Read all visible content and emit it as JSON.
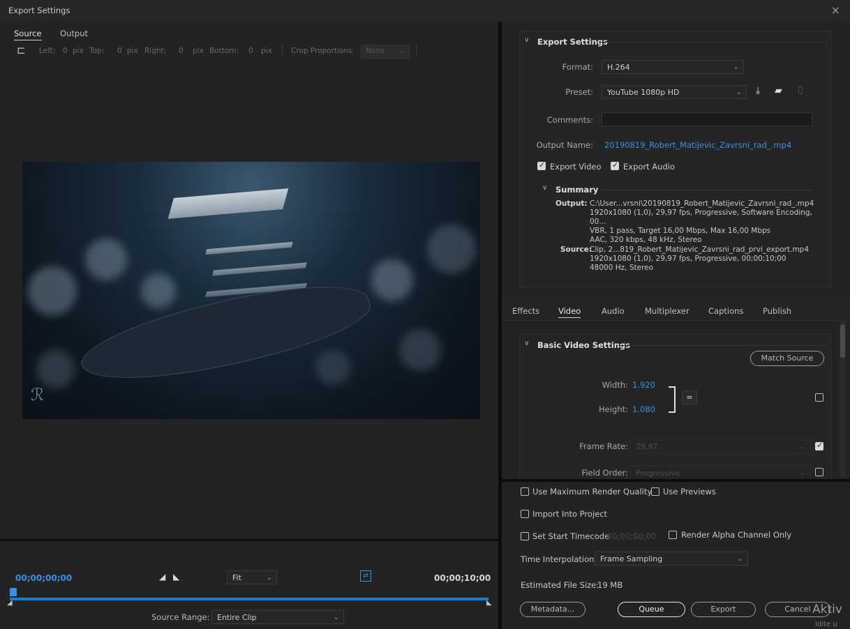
{
  "window": {
    "title": "Export Settings",
    "close": "×"
  },
  "source_panel": {
    "tabs": [
      {
        "label": "Source"
      },
      {
        "label": "Output"
      }
    ],
    "crop": {
      "left_label": "Left:",
      "left_val": "0",
      "top_label": "Top:",
      "top_val": "0",
      "right_label": "Right:",
      "right_val": "0",
      "bottom_label": "Bottom:",
      "bottom_val": "0",
      "unit": "pix",
      "proportions_label": "Crop Proportions:",
      "proportions_value": "None"
    },
    "timecode_start": "00;00;00;00",
    "timecode_end": "00;00;10;00",
    "zoom": "Fit",
    "source_range_label": "Source Range:",
    "source_range_value": "Entire Clip"
  },
  "export_settings": {
    "heading": "Export Settings",
    "format_label": "Format:",
    "format_value": "H.264",
    "preset_label": "Preset:",
    "preset_value": "YouTube 1080p HD",
    "comments_label": "Comments:",
    "comments_value": "",
    "output_name_label": "Output Name:",
    "output_name_value": "20190819_Robert_Matijevic_Zavrsni_rad_.mp4",
    "export_video_label": "Export Video",
    "export_video": true,
    "export_audio_label": "Export Audio",
    "export_audio": true
  },
  "summary": {
    "heading": "Summary",
    "output_label": "Output:",
    "output_lines": [
      "C:\\User...vrsni\\20190819_Robert_Matijevic_Zavrsni_rad_.mp4",
      "1920x1080 (1,0), 29,97 fps, Progressive, Software Encoding, 00...",
      "VBR, 1 pass, Target 16,00 Mbps, Max 16,00 Mbps",
      "AAC, 320 kbps, 48 kHz, Stereo"
    ],
    "source_label": "Source:",
    "source_lines": [
      "Clip, 2...819_Robert_Matijevic_Zavrsni_rad_prvi_export.mp4",
      "1920x1080 (1,0), 29,97 fps, Progressive, 00;00;10;00",
      "48000 Hz, Stereo"
    ]
  },
  "settings_tabs": [
    "Effects",
    "Video",
    "Audio",
    "Multiplexer",
    "Captions",
    "Publish"
  ],
  "video": {
    "heading": "Basic Video Settings",
    "match_source": "Match Source",
    "width_label": "Width:",
    "width_value": "1.920",
    "height_label": "Height:",
    "height_value": "1.080",
    "frame_rate_label": "Frame Rate:",
    "frame_rate_value": "29,97",
    "field_order_label": "Field Order:",
    "field_order_value": "Progressive"
  },
  "options": {
    "max_render_quality": "Use Maximum Render Quality",
    "use_previews": "Use Previews",
    "import_project": "Import Into Project",
    "set_start_timecode": "Set Start Timecode",
    "start_timecode_value": "00;00;00;00",
    "render_alpha": "Render Alpha Channel Only",
    "time_interp_label": "Time Interpolation:",
    "time_interp_value": "Frame Sampling",
    "file_size_label": "Estimated File Size:",
    "file_size_value": "19 MB"
  },
  "buttons": {
    "metadata": "Metadata...",
    "queue": "Queue",
    "export": "Export",
    "cancel": "Cancel"
  },
  "watermark": {
    "line1": "Aktiv",
    "line2": "Idite u"
  },
  "colors": {
    "accent": "#3d8ee6",
    "timeline": "#1a7ad8"
  }
}
